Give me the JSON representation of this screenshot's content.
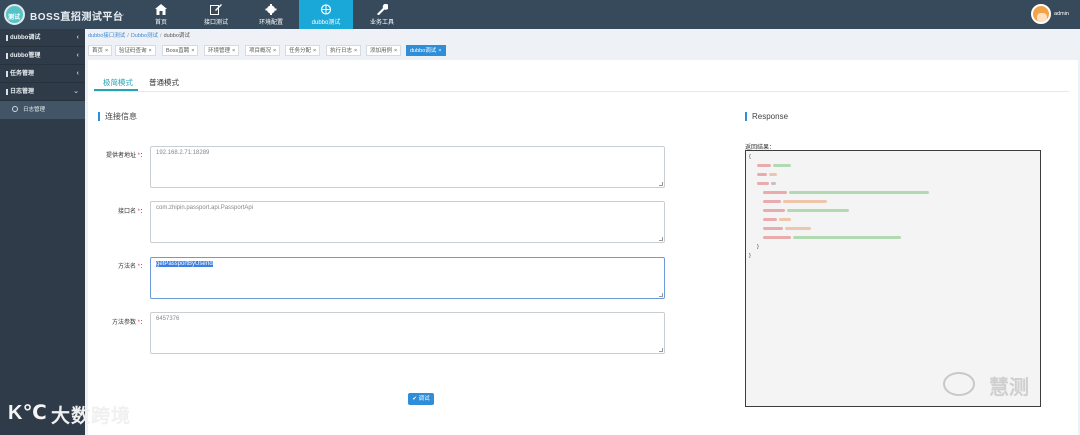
{
  "app": {
    "logo_text": "测试",
    "title": "BOSS直招测试平台"
  },
  "top_nav": [
    {
      "label": "首页",
      "icon": "home-icon"
    },
    {
      "label": "接口测试",
      "icon": "edit-icon"
    },
    {
      "label": "环境配置",
      "icon": "gear-icon"
    },
    {
      "label": "dubbo测试",
      "icon": "globe-icon",
      "active": true
    },
    {
      "label": "业务工具",
      "icon": "wrench-icon"
    }
  ],
  "user": {
    "name": "admin"
  },
  "sidebar": {
    "items": [
      {
        "label": "dubbo调试",
        "caret": "‹"
      },
      {
        "label": "dubbo管理",
        "caret": "‹"
      },
      {
        "label": "任务管理",
        "caret": "‹"
      },
      {
        "label": "日志管理",
        "caret": "⌄"
      }
    ],
    "sub_items": [
      {
        "label": "日志管理"
      }
    ]
  },
  "breadcrumb": [
    "dubbo接口测试",
    "Dubbo测试",
    "dubbo调试"
  ],
  "tabs": [
    {
      "label": "首页"
    },
    {
      "label": "验证码查询"
    },
    {
      "label": "Boss直聘"
    },
    {
      "label": "环境管理"
    },
    {
      "label": "项目概况"
    },
    {
      "label": "任务分配"
    },
    {
      "label": "执行日志"
    },
    {
      "label": "添加用例"
    },
    {
      "label": "dubbo调试",
      "active": true
    }
  ],
  "mode_tabs": [
    {
      "label": "极简模式",
      "active": true
    },
    {
      "label": "普通模式"
    }
  ],
  "connection": {
    "title": "连接信息",
    "fields": [
      {
        "label": "提供者地址",
        "value": "192.168.2.71:18289"
      },
      {
        "label": "接口名",
        "value": "com.zhipin.passport.api.PassportApi"
      },
      {
        "label": "方法名",
        "value": "getPassportByUserId"
      },
      {
        "label": "方法参数",
        "value": "6457376"
      }
    ],
    "submit_label": "调试",
    "required_mark": "*",
    "colon": "："
  },
  "response": {
    "title": "Response",
    "result_label": "返回结果：",
    "open_brace": "{",
    "close_brace": "}",
    "inner_close": "}"
  },
  "watermarks": {
    "wechat_text": "慧测",
    "brand_text": "大数跨境",
    "brand_k": "K℃"
  },
  "colors": {
    "topbar": "#374a5b",
    "nav_active": "#1aa8d8",
    "sidebar": "#2f3b48",
    "accent": "#2e8ed9",
    "mode_accent": "#26a4b6"
  }
}
